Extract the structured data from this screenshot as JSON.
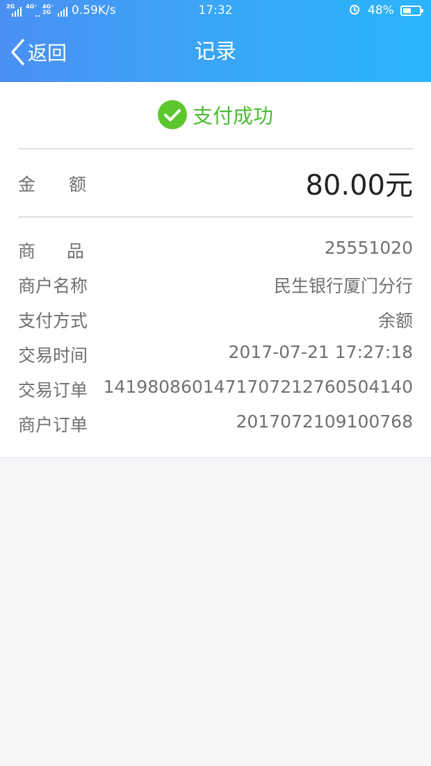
{
  "status_bar": {
    "signal1_tag": "2G",
    "signal2_tag": "4G⁺",
    "signal3_tag": "4G⁺ 2G",
    "speed": "0.59K/s",
    "time": "17:32",
    "alarm_icon": "alarm-clock-icon",
    "battery_pct": "48%",
    "battery_level": 0.48
  },
  "nav": {
    "back_label": "返回",
    "back_icon": "chevron-left-icon",
    "title": "记录"
  },
  "result": {
    "icon": "check-circle-icon",
    "text": "支付成功",
    "color": "#5cc72c"
  },
  "amount": {
    "label": "金额",
    "value": "80.00元"
  },
  "details": [
    {
      "label": "商品",
      "value": "25551020"
    },
    {
      "label": "商户名称",
      "value": "民生银行厦门分行"
    },
    {
      "label": "支付方式",
      "value": "余额"
    },
    {
      "label": "交易时间",
      "value": "2017-07-21 17:27:18"
    },
    {
      "label": "交易订单",
      "value": "1419808601471707212760504140"
    },
    {
      "label": "商户订单",
      "value": "2017072109100768"
    }
  ],
  "colors": {
    "header_start": "#4a90f2",
    "header_end": "#2ab5fb",
    "success_green": "#4fbd35"
  }
}
